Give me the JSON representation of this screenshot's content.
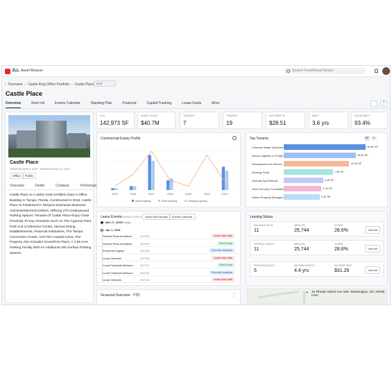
{
  "header": {
    "brand": "JLL",
    "app_name": "Asset Beacon",
    "search_placeholder": "Search Fund/Asset/Tenant"
  },
  "breadcrumbs": [
    "Overview",
    "Castle King Office Portfolio",
    "Castle Place"
  ],
  "breadcrumb_pill": "Unit",
  "page_title": "Castle Place",
  "tabs": [
    "Overview",
    "Rent roll",
    "Events Calendar",
    "Stacking Plan",
    "Financial",
    "Capital Tracking",
    "Lease Deals",
    "More"
  ],
  "property": {
    "name": "Castle Place",
    "created": "CREATED APR 6, 2019 · UPDATED NOV 14, 2024",
    "tags": [
      "Office",
      "Public"
    ],
    "subtabs": [
      "Overview",
      "Fields",
      "Contacts",
      "Performance"
    ],
    "description": "Castle Place Is A LEED Gold Certified Class A Office Building In Tampa, Florida. Constructed In 2016, Castle Place Is Positioned In Tampa's Downtown Business And Entertainment District, Offering 270 Underground Parking Spaces. Tenants Of Castle Place Enjoy Close Proximity To Key Amenities Such As The Cypress Point Park And Conference Center, Various Dining Establishments, Financial Institutions, The Tampa Convention Center, And The Coastal Arena. The Property Also Includes Oceanfront Place, A 1.55 Acre Parking Facility With An Additional 150 Surface Parking Spaces."
  },
  "kpis": [
    {
      "label": "GLA",
      "value": "142,973 SF"
    },
    {
      "label": "ASSET VALUE",
      "value": "$40.7M"
    },
    {
      "label": "TENANTS",
      "value": "7"
    },
    {
      "label": "TENANTS",
      "value": "19"
    },
    {
      "label": "AVG RENT SF",
      "value": "$28.51"
    },
    {
      "label": "WALT",
      "value": "3.6 yrs"
    },
    {
      "label": "OCCUPANCY",
      "value": "93.4%"
    }
  ],
  "expiry_title": "Commercial Expiry Profile",
  "chart_data": {
    "type": "bar",
    "categories": [
      "2025",
      "2026",
      "2027",
      "2028",
      "2029",
      "2030",
      "2031+"
    ],
    "series": [
      {
        "name": "Area expiring",
        "values": [
          1,
          2,
          18,
          5,
          0,
          0,
          12
        ]
      },
      {
        "name": "Rent expiring",
        "values": [
          1,
          2,
          15,
          6,
          0,
          0,
          10
        ]
      },
      {
        "name": "Leasing expiring",
        "values": [
          0,
          0,
          0,
          0,
          0,
          0,
          0
        ]
      }
    ],
    "legend": [
      "Area expiring",
      "Rent expiring",
      "Leasing expiring"
    ],
    "line": [
      2,
      8,
      20,
      5,
      2,
      18,
      4
    ],
    "legend_position": "bottom"
  },
  "top_tenants": {
    "title": "Top Tenants",
    "toggle": [
      "SF",
      "%"
    ],
    "items": [
      {
        "name": "Cascade Water Solutions",
        "value": "16.6K SF",
        "pct": 1.0,
        "color": "#5b8fe0"
      },
      {
        "name": "Nexus Logistics & Freight",
        "value": "15.2K SF",
        "pct": 0.88,
        "color": "#9cc3f0"
      },
      {
        "name": "Renaissance Art Studios",
        "value": "14.2K SF",
        "pct": 0.8,
        "color": "#f5b89a"
      },
      {
        "name": "Synergy Solar",
        "value": "7.9K SF",
        "pct": 0.6,
        "color": "#a7e3de"
      },
      {
        "name": "Serenity Spa Retreat",
        "value": "4.4K SF",
        "pct": 0.48,
        "color": "#c5c9f5"
      },
      {
        "name": "Orion Security Consultants",
        "value": "3.7K SF",
        "pct": 0.46,
        "color": "#f4b7d6"
      },
      {
        "name": "Haven Property Managem...",
        "value": "2.1K SF",
        "pct": 0.44,
        "color": "#b9dcf7"
      }
    ]
  },
  "lease_events": {
    "title": "Lease Events",
    "subtitle": "SHOWING 6 EVENTS",
    "buttons": [
      "Show Rent Bumps",
      "Events Calendar"
    ],
    "groups": [
      {
        "date": "Mar 17, 2025",
        "note": "(Today)"
      },
      {
        "date": "Apr 1, 2025",
        "note": ""
      }
    ],
    "items": [
      {
        "name": "Summit Peak Architects",
        "unit": "UNIT 803",
        "badge": "Lease start date",
        "type": "red"
      },
      {
        "name": "Summit Peak Architects",
        "unit": "UNIT 803",
        "badge": "Rent bump",
        "type": "green"
      },
      {
        "name": "EchoPoint Digital",
        "unit": "UNIT 804",
        "badge": "Exercise deadline",
        "type": "blue"
      },
      {
        "name": "Lunar Ventures",
        "unit": "UNIT 902",
        "badge": "Lease start date",
        "type": "red"
      },
      {
        "name": "Lunar Financial Advisors",
        "unit": "UNIT 901",
        "badge": "Rent bump",
        "type": "green"
      },
      {
        "name": "Lunar Financial Advisors",
        "unit": "UNIT 901",
        "badge": "Exercise deadline",
        "type": "blue"
      },
      {
        "name": "Lunar Ventures",
        "unit": "UNIT 902",
        "badge": "Lease start date",
        "type": "red"
      }
    ]
  },
  "leasing_status": {
    "title": "Leasing Status",
    "rows": [
      {
        "cells": [
          {
            "label": "AVAILABLE UNITS",
            "value": "11"
          },
          {
            "label": "AREA (SF)",
            "value": "25,744"
          },
          {
            "label": "% AREA",
            "value": "28.6%"
          }
        ],
        "action": "View All"
      },
      {
        "cells": [
          {
            "label": "EXPIRING LEASES",
            "value": "11"
          },
          {
            "label": "AREA (SF)",
            "value": "25,744"
          },
          {
            "label": "% AREA",
            "value": "28.6%"
          }
        ],
        "action": "View All"
      },
      {
        "cells": [
          {
            "label": "PROPOSED DEALS",
            "value": "5"
          },
          {
            "label": "WA TERM LENGTH",
            "value": "4.4 yrs"
          },
          {
            "label": "WA START RENT",
            "value": "$31.26"
          }
        ],
        "action": "View All"
      }
    ]
  },
  "financial_title": "Financial Overview - YTD",
  "map_label": "12 Rhode Island Ave NW, Washington, DC 20005, USA"
}
